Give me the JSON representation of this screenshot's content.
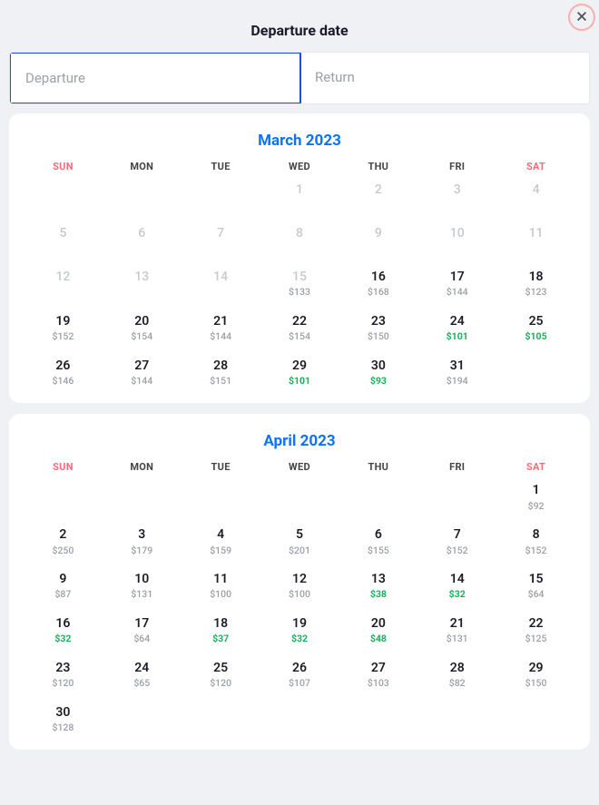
{
  "header": {
    "title": "Departure date"
  },
  "tabs": {
    "departure": "Departure",
    "return": "Return",
    "active": "departure"
  },
  "weekdays": [
    "SUN",
    "MON",
    "TUE",
    "WED",
    "THU",
    "FRI",
    "SAT"
  ],
  "months": [
    {
      "title": "March 2023",
      "leading_blanks": 3,
      "days": [
        {
          "n": 1,
          "disabled": true
        },
        {
          "n": 2,
          "disabled": true
        },
        {
          "n": 3,
          "disabled": true
        },
        {
          "n": 4,
          "disabled": true
        },
        {
          "n": 5,
          "disabled": true
        },
        {
          "n": 6,
          "disabled": true
        },
        {
          "n": 7,
          "disabled": true
        },
        {
          "n": 8,
          "disabled": true
        },
        {
          "n": 9,
          "disabled": true
        },
        {
          "n": 10,
          "disabled": true
        },
        {
          "n": 11,
          "disabled": true
        },
        {
          "n": 12,
          "disabled": true
        },
        {
          "n": 13,
          "disabled": true
        },
        {
          "n": 14,
          "disabled": true
        },
        {
          "n": 15,
          "disabled": true,
          "price": "$133"
        },
        {
          "n": 16,
          "price": "$168"
        },
        {
          "n": 17,
          "price": "$144"
        },
        {
          "n": 18,
          "price": "$123"
        },
        {
          "n": 19,
          "price": "$152"
        },
        {
          "n": 20,
          "price": "$154"
        },
        {
          "n": 21,
          "price": "$144"
        },
        {
          "n": 22,
          "price": "$154"
        },
        {
          "n": 23,
          "price": "$150"
        },
        {
          "n": 24,
          "price": "$101",
          "cheap": true
        },
        {
          "n": 25,
          "price": "$105",
          "cheap": true
        },
        {
          "n": 26,
          "price": "$146"
        },
        {
          "n": 27,
          "price": "$144"
        },
        {
          "n": 28,
          "price": "$151"
        },
        {
          "n": 29,
          "price": "$101",
          "cheap": true
        },
        {
          "n": 30,
          "price": "$93",
          "cheap": true
        },
        {
          "n": 31,
          "price": "$194"
        }
      ]
    },
    {
      "title": "April 2023",
      "leading_blanks": 6,
      "days": [
        {
          "n": 1,
          "price": "$92"
        },
        {
          "n": 2,
          "price": "$250"
        },
        {
          "n": 3,
          "price": "$179"
        },
        {
          "n": 4,
          "price": "$159"
        },
        {
          "n": 5,
          "price": "$201"
        },
        {
          "n": 6,
          "price": "$155"
        },
        {
          "n": 7,
          "price": "$152"
        },
        {
          "n": 8,
          "price": "$152"
        },
        {
          "n": 9,
          "price": "$87"
        },
        {
          "n": 10,
          "price": "$131"
        },
        {
          "n": 11,
          "price": "$100"
        },
        {
          "n": 12,
          "price": "$100"
        },
        {
          "n": 13,
          "price": "$38",
          "cheap": true
        },
        {
          "n": 14,
          "price": "$32",
          "cheap": true
        },
        {
          "n": 15,
          "price": "$64"
        },
        {
          "n": 16,
          "price": "$32",
          "cheap": true
        },
        {
          "n": 17,
          "price": "$64"
        },
        {
          "n": 18,
          "price": "$37",
          "cheap": true
        },
        {
          "n": 19,
          "price": "$32",
          "cheap": true
        },
        {
          "n": 20,
          "price": "$48",
          "cheap": true
        },
        {
          "n": 21,
          "price": "$131"
        },
        {
          "n": 22,
          "price": "$125"
        },
        {
          "n": 23,
          "price": "$120"
        },
        {
          "n": 24,
          "price": "$65"
        },
        {
          "n": 25,
          "price": "$120"
        },
        {
          "n": 26,
          "price": "$107"
        },
        {
          "n": 27,
          "price": "$103"
        },
        {
          "n": 28,
          "price": "$82"
        },
        {
          "n": 29,
          "price": "$150"
        },
        {
          "n": 30,
          "price": "$128"
        }
      ]
    }
  ]
}
